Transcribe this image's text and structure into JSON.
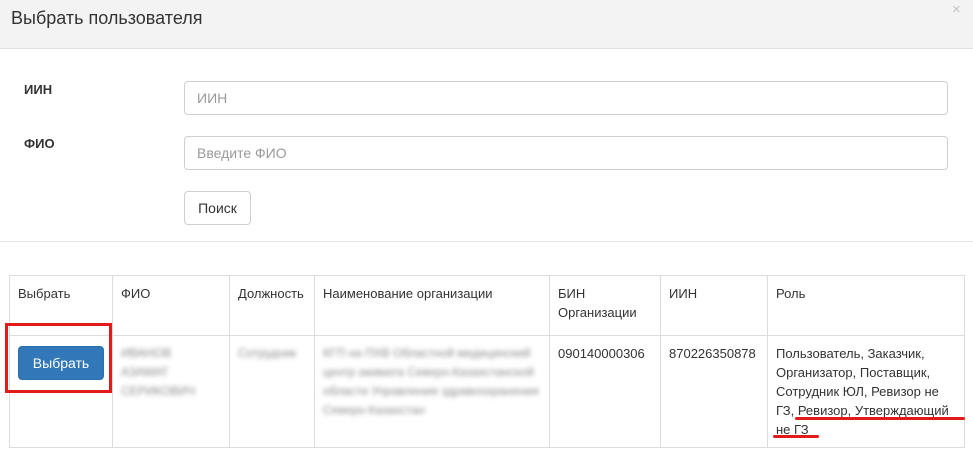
{
  "modal": {
    "title": "Выбрать пользователя",
    "close": "×"
  },
  "form": {
    "iin": {
      "label": "ИИН",
      "placeholder": "ИИН"
    },
    "fio": {
      "label": "ФИО",
      "placeholder": "Введите ФИО"
    },
    "search_label": "Поиск"
  },
  "table": {
    "headers": [
      "Выбрать",
      "ФИО",
      "Должность",
      "Наименование организации",
      "БИН Организации",
      "ИИН",
      "Роль"
    ],
    "rows": [
      {
        "select_label": "Выбрать",
        "fio": "ИВАНОВ АЗАМАТ СЕРИКОВИЧ",
        "position": "Сотрудник",
        "organization": "КГП на ПХВ Областной медицинский центр акимата Северо-Казахстанской области Управления здравоохранения Северо-Казахстан",
        "bin": "090140000306",
        "iin": "870226350878",
        "roles": "Пользователь, Заказчик, Организатор, Поставщик, Сотрудник ЮЛ, Ревизор не ГЗ, Ревизор, Утверждающий не ГЗ"
      }
    ]
  },
  "colors": {
    "accent": "#3278b8",
    "highlight": "#e21a1a"
  }
}
